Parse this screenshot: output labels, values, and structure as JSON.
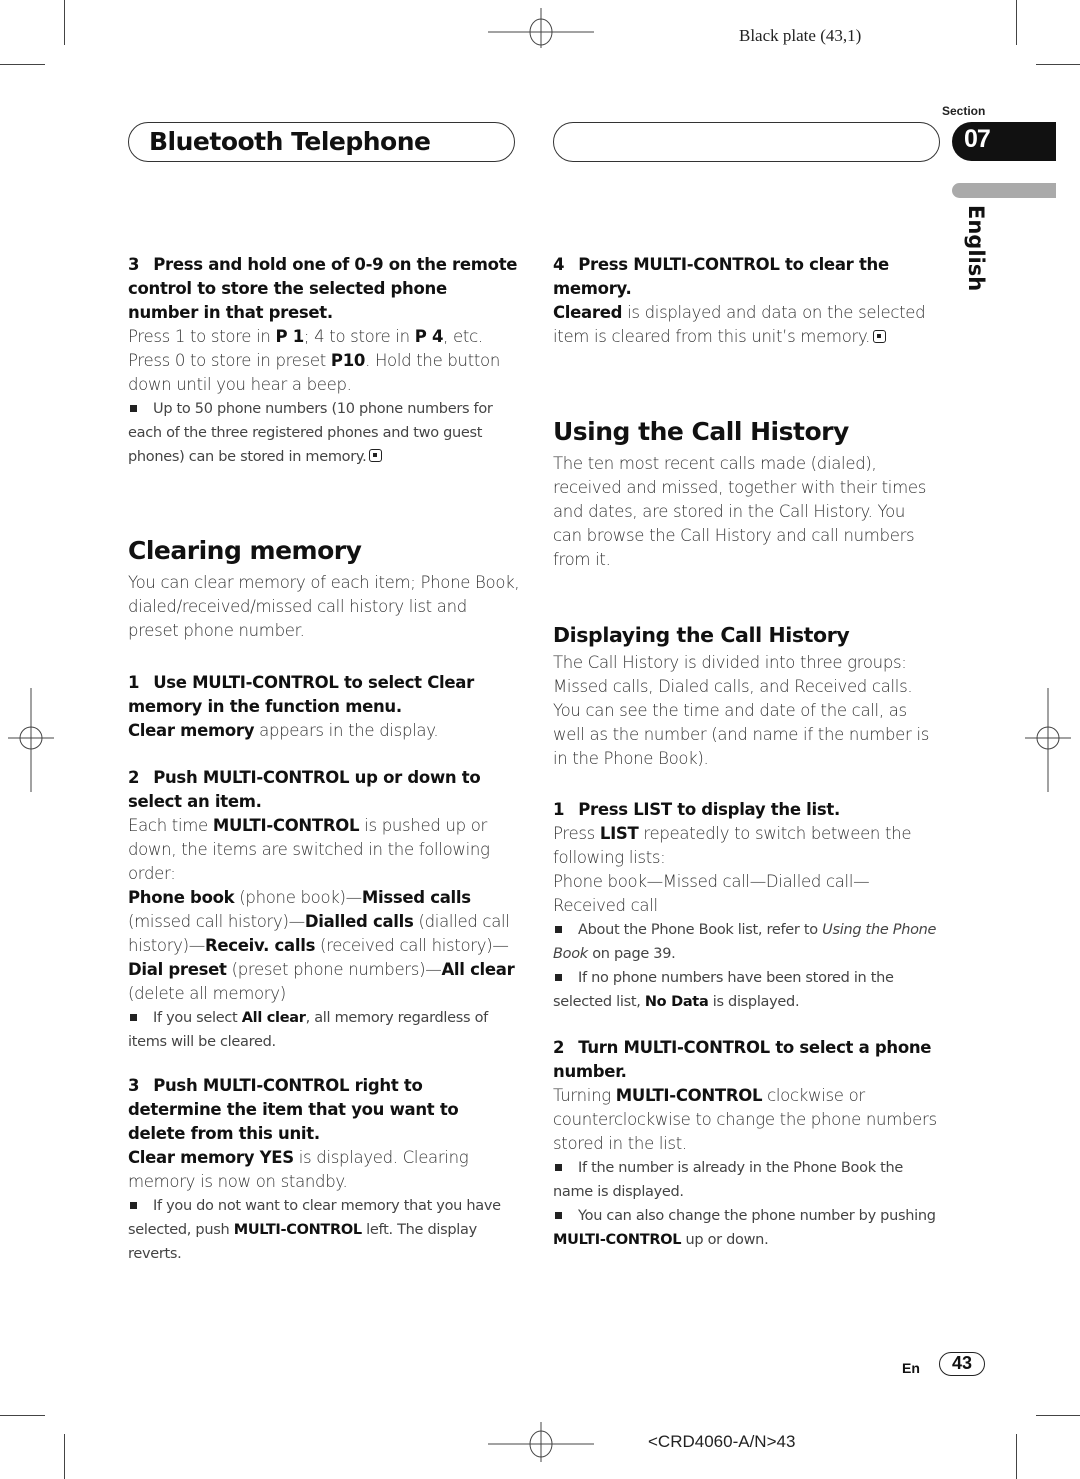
{
  "print_marks": {
    "plate": "Black plate (43,1)",
    "footer_code": "<CRD4060-A/N>43"
  },
  "header": {
    "title": "Bluetooth Telephone",
    "section_label": "Section",
    "section_number": "07",
    "language": "English"
  },
  "left_column": {
    "step3": {
      "number": "3",
      "title": "Press and hold one of 0-9 on the remote control to store the selected phone number in that preset.",
      "body": [
        {
          "t": "Press 1 to store in "
        },
        {
          "b": "P 1"
        },
        {
          "t": "; 4 to store in "
        },
        {
          "b": "P 4"
        },
        {
          "t": ", etc. Press 0 to store in preset "
        },
        {
          "b": "P10"
        },
        {
          "t": ". Hold the button down until you hear a beep."
        }
      ],
      "note": "Up to 50 phone numbers (10 phone numbers for each of the three registered phones and two guest phones) can be stored in memory."
    },
    "clearing_memory": {
      "heading": "Clearing memory",
      "intro": "You can clear memory of each item; Phone Book, dialed/received/missed call history list and preset phone number.",
      "step1": {
        "number": "1",
        "title": "Use MULTI-CONTROL to select Clear memory in the function menu.",
        "body_bold": "Clear memory",
        "body_rest": " appears in the display."
      },
      "step2": {
        "number": "2",
        "title": "Push MULTI-CONTROL up or down to select an item.",
        "body_pre": "Each time ",
        "body_bold": "MULTI-CONTROL",
        "body_post": " is pushed up or down, the items are switched in the following order:",
        "order": [
          {
            "b": "Phone book"
          },
          {
            "t": " (phone book)—"
          },
          {
            "b": "Missed calls"
          },
          {
            "t": " (missed call history)—"
          },
          {
            "b": "Dialled calls"
          },
          {
            "t": " (dialled call history)—"
          },
          {
            "b": "Receiv. calls"
          },
          {
            "t": " (received call history)—"
          },
          {
            "b": "Dial preset"
          },
          {
            "t": " (preset phone numbers)—"
          },
          {
            "b": "All clear"
          },
          {
            "t": " (delete all memory)"
          }
        ],
        "note_pre": "If you select ",
        "note_bold": "All clear",
        "note_post": ", all memory regardless of items will be cleared."
      },
      "step3": {
        "number": "3",
        "title": "Push MULTI-CONTROL right to determine the item that you want to delete from this unit.",
        "body_bold": "Clear memory YES",
        "body_rest": " is displayed. Clearing memory is now on standby.",
        "note_pre": "If you do not want to clear memory that you have selected, push ",
        "note_bold": "MULTI-CONTROL",
        "note_post": " left. The display reverts."
      }
    }
  },
  "right_column": {
    "step4": {
      "number": "4",
      "title": "Press MULTI-CONTROL to clear the memory.",
      "body_bold": "Cleared",
      "body_rest": " is displayed and data on the selected item is cleared from this unit’s memory."
    },
    "call_history": {
      "heading": "Using the Call History",
      "intro": "The ten most recent calls made (dialed), received and missed, together with their times and dates, are stored in the Call History. You can browse the Call History and call numbers from it.",
      "displaying": {
        "heading": "Displaying the Call History",
        "intro": "The Call History is divided into three groups: Missed calls, Dialed calls, and Received calls. You can see the time and date of the call, as well as the number (and name if the number is in the Phone Book).",
        "step1": {
          "number": "1",
          "title": "Press LIST to display the list.",
          "body_pre": "Press ",
          "body_bold": "LIST",
          "body_post": " repeatedly to switch between the following lists:",
          "list_order": "Phone book—Missed call—Dialled call—Received call",
          "note1_pre": "About the Phone Book list, refer to ",
          "note1_italic": "Using the Phone Book",
          "note1_post": " on page 39.",
          "note2_pre": "If no phone numbers have been stored in the selected list, ",
          "note2_bold": "No Data",
          "note2_post": " is displayed."
        },
        "step2": {
          "number": "2",
          "title": "Turn MULTI-CONTROL to select a phone number.",
          "body_pre": "Turning ",
          "body_bold": "MULTI-CONTROL",
          "body_post": " clockwise or counterclockwise to change the phone numbers stored in the list.",
          "note1": "If the number is already in the Phone Book the name is displayed.",
          "note2_pre": "You can also change the phone number by pushing ",
          "note2_bold": "MULTI-CONTROL",
          "note2_post": " up or down."
        }
      }
    }
  },
  "footer": {
    "language_code": "En",
    "page_number": "43"
  }
}
